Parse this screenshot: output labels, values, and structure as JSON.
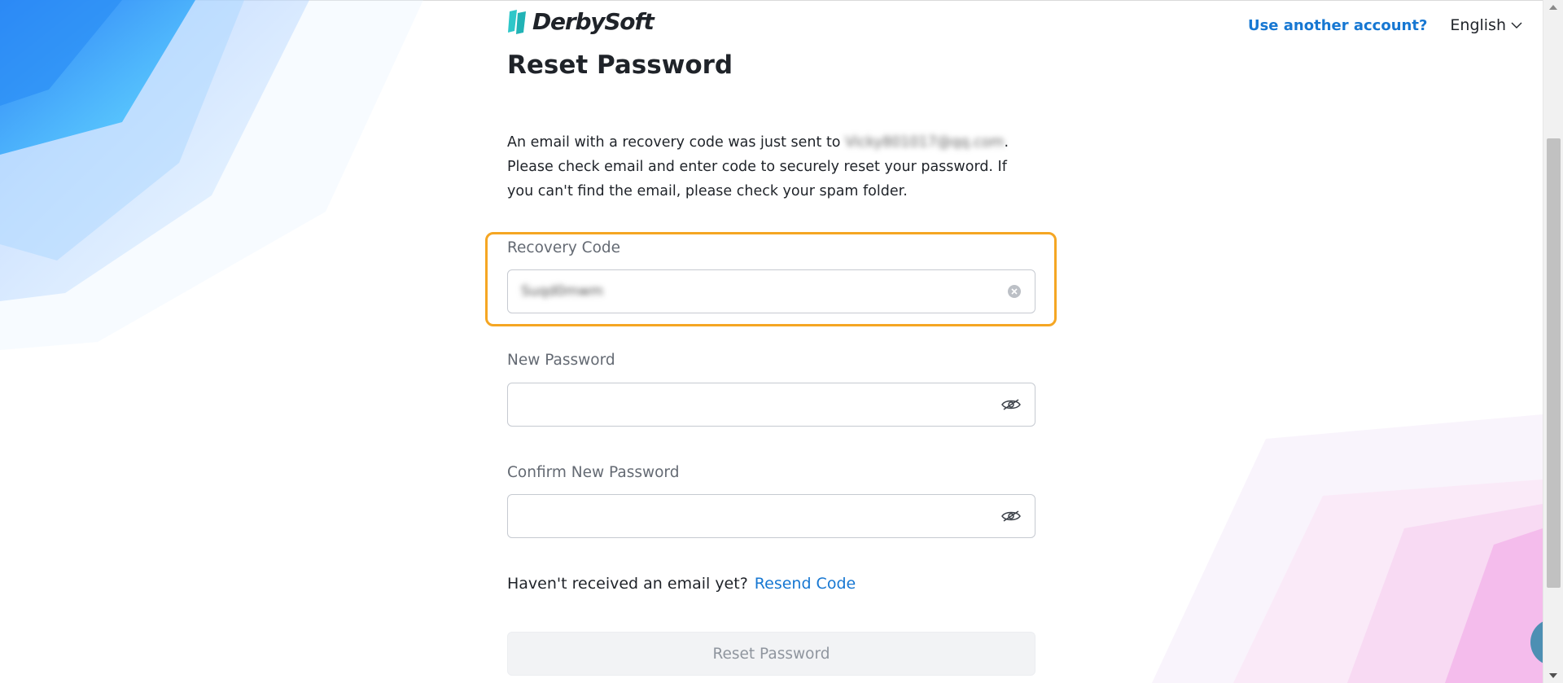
{
  "header": {
    "brand": "DerbySoft",
    "use_another_account": "Use another account?",
    "language": "English"
  },
  "main": {
    "title": "Reset Password",
    "description_before_email": "An email with a recovery code was just sent to ",
    "masked_email": "Vicky801017@qq.com",
    "description_after_email": ". Please check email and enter code to securely reset your password. If you can't find the email, please check your spam folder.",
    "recovery_code": {
      "label": "Recovery Code",
      "value": "Suqd0mwm"
    },
    "new_password": {
      "label": "New Password",
      "value": ""
    },
    "confirm_password": {
      "label": "Confirm New Password",
      "value": ""
    },
    "resend_prompt": "Haven't received an email yet?",
    "resend_link": "Resend Code",
    "submit_label": "Reset Password"
  },
  "colors": {
    "accent": "#1677d2",
    "highlight": "#f5a623",
    "brand_mark": "#2ec7c9"
  }
}
